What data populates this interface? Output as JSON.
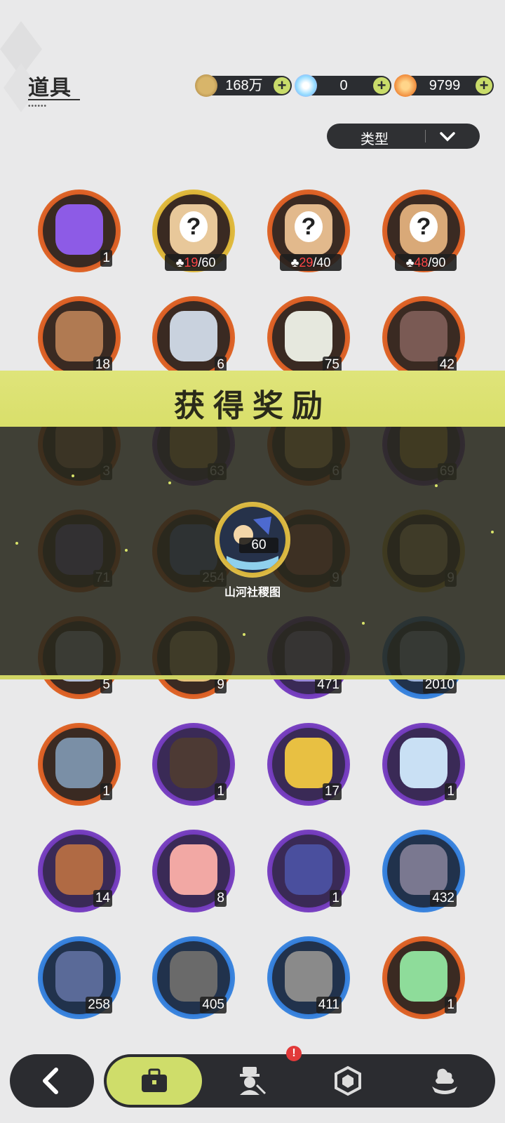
{
  "header": {
    "title": "道具"
  },
  "currencies": [
    {
      "icon": "gold-coin-icon",
      "value": "168万",
      "add": "+"
    },
    {
      "icon": "crystal-icon",
      "value": "0",
      "add": "+"
    },
    {
      "icon": "star-shard-icon",
      "value": "9799",
      "add": "+"
    }
  ],
  "filter": {
    "label": "类型"
  },
  "items": [
    {
      "icon": "purple-crystal-compass-icon",
      "count": "1"
    },
    {
      "icon": "mystery-doll-icon",
      "frag_have": "19",
      "frag_total": "/60"
    },
    {
      "icon": "mystery-doll-icon",
      "frag_have": "29",
      "frag_total": "/40"
    },
    {
      "icon": "mystery-doll-icon",
      "frag_have": "48",
      "frag_total": "/90"
    },
    {
      "icon": "teddy-bear-icon",
      "count": "18"
    },
    {
      "icon": "knight-helmet-icon",
      "count": "6"
    },
    {
      "icon": "white-creature-icon",
      "count": "75"
    },
    {
      "icon": "eyepatch-bear-icon",
      "count": "42"
    },
    {
      "icon": "character-icon",
      "count": "3"
    },
    {
      "icon": "character-icon",
      "count": "63"
    },
    {
      "icon": "character-icon",
      "count": "6"
    },
    {
      "icon": "character-icon",
      "count": "69"
    },
    {
      "icon": "spiky-star-icon",
      "count": "71"
    },
    {
      "icon": "spiky-star-icon",
      "count": "254"
    },
    {
      "icon": "paw-icon",
      "count": "9"
    },
    {
      "icon": "card-icon",
      "count": "9"
    },
    {
      "icon": "card-icon",
      "count": "5"
    },
    {
      "icon": "card-icon",
      "count": "9"
    },
    {
      "icon": "card-icon",
      "count": "471"
    },
    {
      "icon": "card-icon",
      "count": "2010"
    },
    {
      "icon": "refresh-card-icon",
      "count": "1"
    },
    {
      "icon": "gift-box-icon",
      "count": "1"
    },
    {
      "icon": "golden-egg-icon",
      "count": "17"
    },
    {
      "icon": "magic-mirror-icon",
      "count": "1"
    },
    {
      "icon": "scroll-icon",
      "count": "14"
    },
    {
      "icon": "pink-apple-icon",
      "count": "8"
    },
    {
      "icon": "quill-book-icon",
      "count": "1"
    },
    {
      "icon": "shovel-icon",
      "count": "432"
    },
    {
      "icon": "boxing-glove-icon",
      "count": "258"
    },
    {
      "icon": "pickaxe-icon",
      "count": "405"
    },
    {
      "icon": "hammer-icon",
      "count": "411"
    },
    {
      "icon": "green-cloud-icon",
      "count": "1"
    }
  ],
  "reward_popup": {
    "title": "获得奖励",
    "item_name": "山河社稷图",
    "item_count": "60"
  },
  "bottom_nav": {
    "badge": "!",
    "tabs": [
      "back-arrow-icon",
      "bag-icon",
      "character-icon",
      "hexagon-icon",
      "pudding-icon"
    ]
  }
}
